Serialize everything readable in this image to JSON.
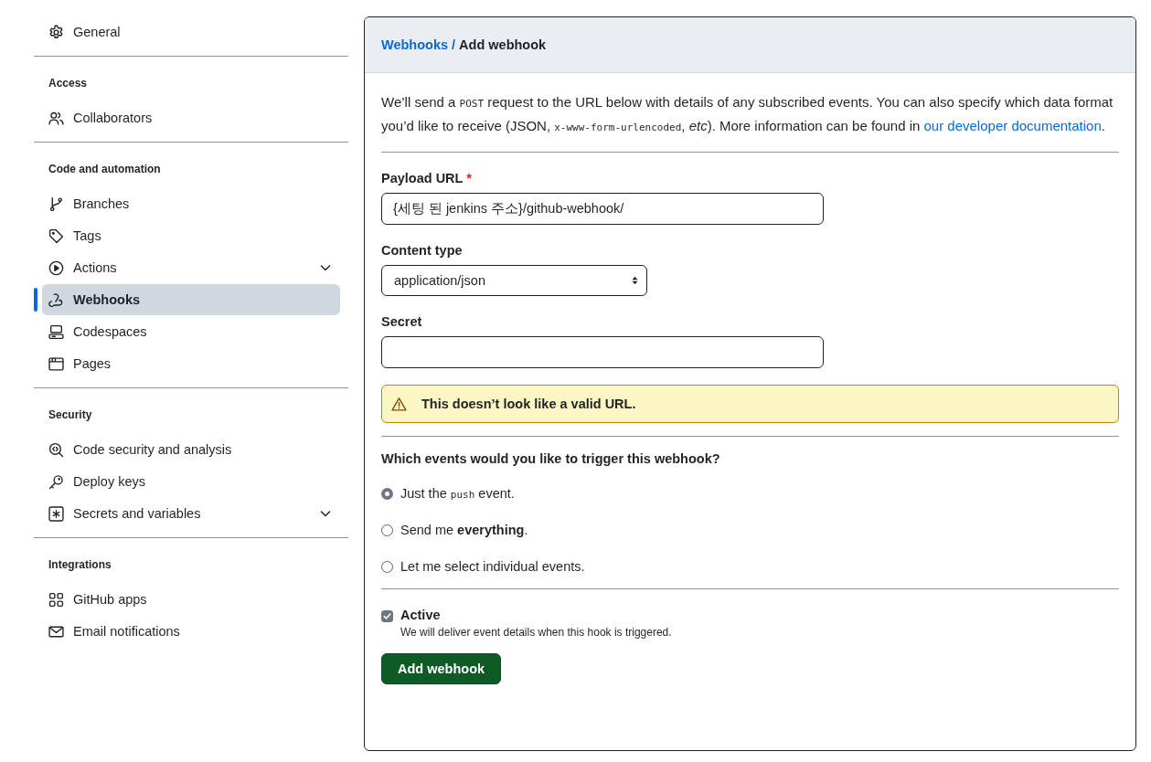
{
  "sidebar": {
    "sections": [
      {
        "items": [
          {
            "label": "General",
            "kind": "gear",
            "selected": false,
            "expandable": false
          }
        ]
      },
      {
        "heading": "Access",
        "items": [
          {
            "label": "Collaborators",
            "kind": "people",
            "selected": false,
            "expandable": false
          }
        ]
      },
      {
        "heading": "Code and automation",
        "items": [
          {
            "label": "Branches",
            "kind": "branch",
            "selected": false,
            "expandable": false
          },
          {
            "label": "Tags",
            "kind": "tag",
            "selected": false,
            "expandable": false
          },
          {
            "label": "Actions",
            "kind": "play",
            "selected": false,
            "expandable": true
          },
          {
            "label": "Webhooks",
            "kind": "webhook",
            "selected": true,
            "expandable": false
          },
          {
            "label": "Codespaces",
            "kind": "codespaces",
            "selected": false,
            "expandable": false
          },
          {
            "label": "Pages",
            "kind": "browser",
            "selected": false,
            "expandable": false
          }
        ]
      },
      {
        "heading": "Security",
        "items": [
          {
            "label": "Code security and analysis",
            "kind": "codescan",
            "selected": false,
            "expandable": false
          },
          {
            "label": "Deploy keys",
            "kind": "key",
            "selected": false,
            "expandable": false
          },
          {
            "label": "Secrets and variables",
            "kind": "asterisk",
            "selected": false,
            "expandable": true
          }
        ]
      },
      {
        "heading": "Integrations",
        "items": [
          {
            "label": "GitHub apps",
            "kind": "apps",
            "selected": false,
            "expandable": false
          },
          {
            "label": "Email notifications",
            "kind": "mail",
            "selected": false,
            "expandable": false
          }
        ]
      }
    ]
  },
  "panel": {
    "breadcrumb": {
      "link": "Webhooks",
      "separator": "/",
      "current": "Add webhook"
    },
    "intro": [
      {
        "kind": "text",
        "text": "We’ll send a "
      },
      {
        "kind": "code",
        "text": "POST"
      },
      {
        "kind": "text",
        "text": " request to the URL below with details of any subscribed events. You can also specify which data format you’d like to receive (JSON, "
      },
      {
        "kind": "code",
        "text": "x-www-form-urlencoded"
      },
      {
        "kind": "text",
        "text": ", "
      },
      {
        "kind": "italic",
        "text": "etc"
      },
      {
        "kind": "text",
        "text": "). More information can be found in "
      },
      {
        "kind": "link",
        "text": "our developer documentation"
      },
      {
        "kind": "text",
        "text": "."
      }
    ],
    "payload_url": {
      "label": "Payload URL",
      "required_mark": "*",
      "value": "{세팅 된 jenkins 주소}/github-webhook/"
    },
    "content_type": {
      "label": "Content type",
      "value": "application/json"
    },
    "secret": {
      "label": "Secret"
    },
    "warning": "This doesn’t look like a valid URL.",
    "events": {
      "question": "Which events would you like to trigger this webhook?",
      "options": [
        {
          "selected": true,
          "label": [
            {
              "kind": "text",
              "text": "Just the "
            },
            {
              "kind": "code",
              "text": "push"
            },
            {
              "kind": "text",
              "text": " event."
            }
          ]
        },
        {
          "selected": false,
          "label": [
            {
              "kind": "text",
              "text": "Send me "
            },
            {
              "kind": "bold",
              "text": "everything"
            },
            {
              "kind": "text",
              "text": "."
            }
          ]
        },
        {
          "selected": false,
          "label": [
            {
              "kind": "text",
              "text": "Let me select individual events."
            }
          ]
        }
      ]
    },
    "active": {
      "label": "Active",
      "checked": true,
      "description": "We will deliver event details when this hook is triggered."
    },
    "submit": "Add webhook"
  }
}
